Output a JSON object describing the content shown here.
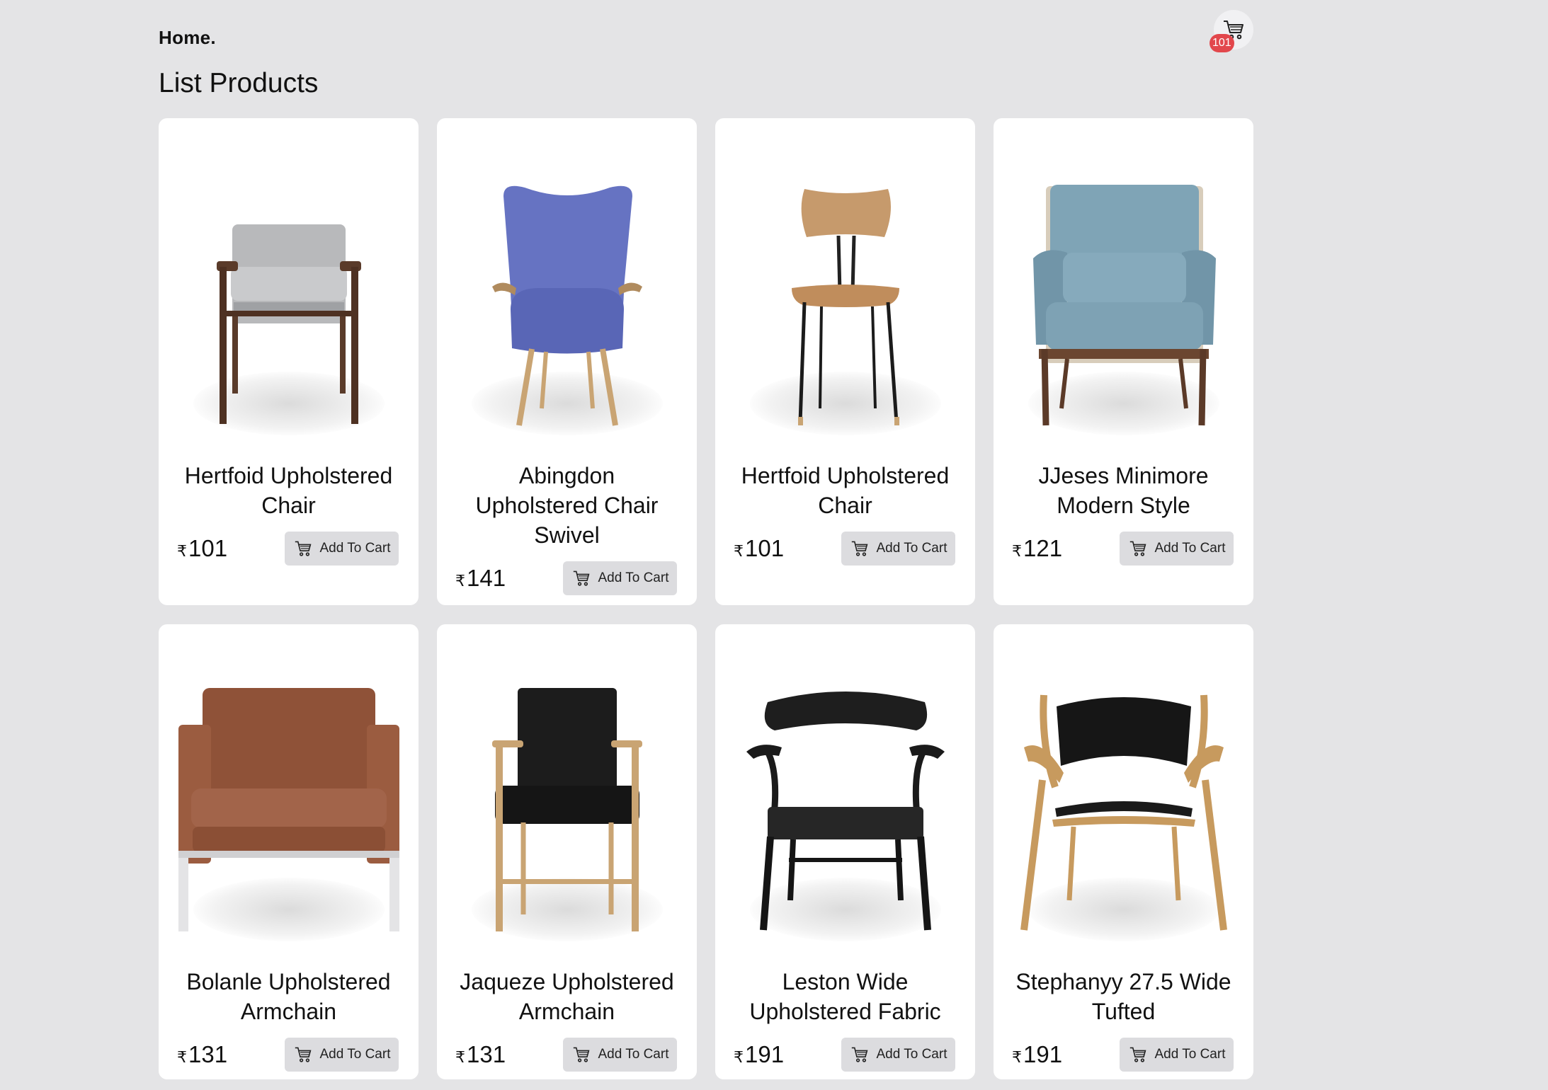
{
  "header": {
    "brand": "Home.",
    "cart_count": "101"
  },
  "page_title": "List Products",
  "currency_symbol": "₹",
  "button_label": "Add To Cart",
  "products": [
    {
      "name": "Hertfoid Upholstered Chair",
      "price": "101",
      "image": "grey-armchair"
    },
    {
      "name": "Abingdon Upholstered Chair Swivel",
      "price": "141",
      "image": "blue-wingback-chair"
    },
    {
      "name": "Hertfoid Upholstered Chair",
      "price": "101",
      "image": "wood-stacking-chair"
    },
    {
      "name": "JJeses Minimore Modern Style",
      "price": "121",
      "image": "blue-lounge-chair"
    },
    {
      "name": "Bolanle Upholstered Armchain",
      "price": "131",
      "image": "brown-leather-armchair"
    },
    {
      "name": "Jaqueze Upholstered Armchain",
      "price": "131",
      "image": "black-leather-oak-chair"
    },
    {
      "name": "Leston Wide Upholstered Fabric",
      "price": "191",
      "image": "black-wishbone-chair"
    },
    {
      "name": "Stephanyy 27.5 Wide Tufted",
      "price": "191",
      "image": "oak-shell-chair"
    }
  ]
}
